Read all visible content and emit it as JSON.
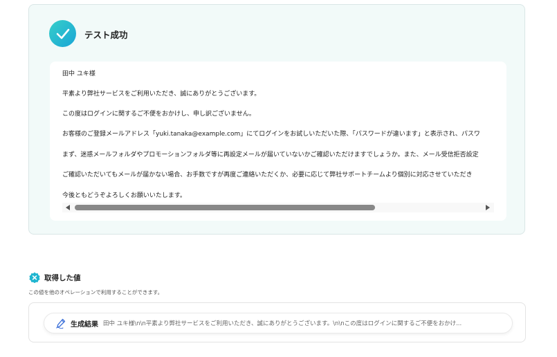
{
  "colors": {
    "accent": "#1fb5d0",
    "card_bg": "#f2faf9"
  },
  "test_result": {
    "icon": "check-circle-icon",
    "title": "テスト成功",
    "email_lines": [
      "田中 ユキ様",
      "平素より弊社サービスをご利用いただき、誠にありがとうございます。",
      "この度はログインに関するご不便をおかけし、申し訳ございません。",
      "お客様のご登録メールアドレス「yuki.tanaka@example.com」にてログインをお試しいただいた際、「パスワードが違います」と表示され、パスワ",
      "まず、迷惑メールフォルダやプロモーションフォルダ等に再設定メールが届いていないかご確認いただけますでしょうか。また、メール受信拒否設定",
      "ご確認いただいてもメールが届かない場合、お手数ですが再度ご連絡いただくか、必要に応じて弊社サポートチームより個別に対応させていただき",
      "今後ともどうぞよろしくお願いいたします。"
    ]
  },
  "output_section": {
    "icon": "badge-x-icon",
    "title": "取得した値",
    "description": "この値を他のオペレーションで利用することができます。",
    "field": {
      "icon": "pen-icon",
      "label": "生成結果",
      "value": "田中 ユキ様\\n\\n平素より弊社サービスをご利用いただき、誠にありがとうございます。\\n\\nこの度はログインに関するご不便をおかけ..."
    }
  }
}
